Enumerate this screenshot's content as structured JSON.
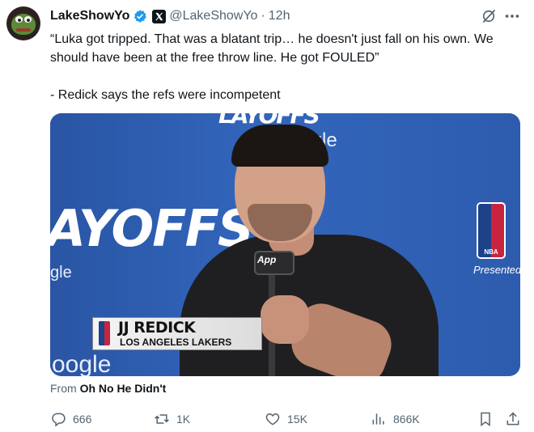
{
  "tweet": {
    "author_name": "LakeShowYo",
    "handle": "@LakeShowYo",
    "separator": "·",
    "time": "12h",
    "text": "“Luka got tripped. That was a blatant trip… he doesn't just fall on his own. We should have been at the free throw line. He got FOULED”\n\n- Redick says the refs were incompetent"
  },
  "media": {
    "wall_text_top": "oogle",
    "wall_wordmark_top": "LAYOFFS",
    "wall_wordmark_left": "AYOFFS",
    "wall_sponsor_left": "gle",
    "wall_sponsor_bottom": "oogle",
    "nba_badge": "NBA",
    "presented_by": "Presented by",
    "mic_label": "App",
    "lower_third_name": "JJ REDICK",
    "lower_third_team": "LOS ANGELES LAKERS"
  },
  "source": {
    "prefix": "From",
    "account": "Oh No He Didn't"
  },
  "actions": {
    "replies": "666",
    "reposts": "1K",
    "likes": "15K",
    "views": "866K"
  },
  "colors": {
    "text_primary": "#0f1419",
    "text_secondary": "#536471",
    "verified_blue": "#1d9bf0",
    "wall_blue": "#2f5fb0"
  },
  "icons": [
    "verified-badge-icon",
    "x-affiliate-icon",
    "grok-icon",
    "more-icon",
    "reply-icon",
    "repost-icon",
    "like-icon",
    "views-icon",
    "bookmark-icon",
    "share-icon"
  ]
}
